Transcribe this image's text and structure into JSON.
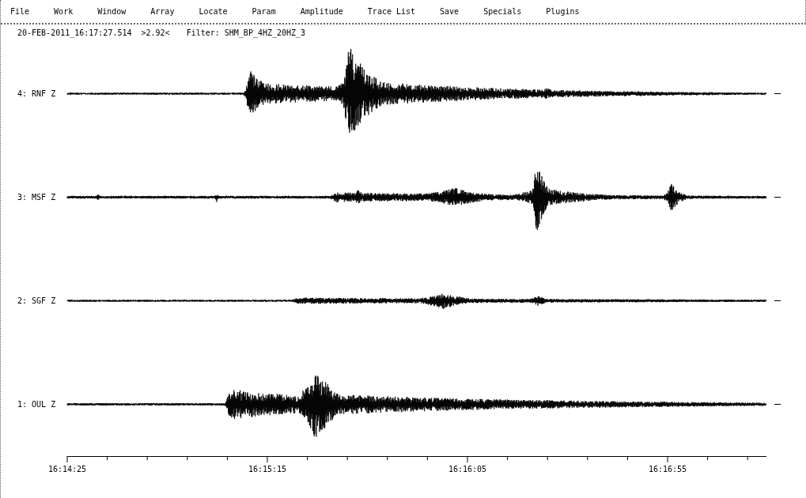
{
  "menu": [
    {
      "label": "File"
    },
    {
      "label": "Work"
    },
    {
      "label": "Window"
    },
    {
      "label": "Array"
    },
    {
      "label": "Locate"
    },
    {
      "label": "Param"
    },
    {
      "label": "Amplitude"
    },
    {
      "label": "Trace List"
    },
    {
      "label": "Save"
    },
    {
      "label": "Specials"
    },
    {
      "label": "Plugins"
    }
  ],
  "header": {
    "timestamp": "20-FEB-2011_16:17:27.514",
    "amplitude": ">2.92<",
    "filter": "Filter: SHM_BP_4HZ_20HZ_3"
  },
  "traces": [
    {
      "label": "4: RNF Z"
    },
    {
      "label": "3: MSF Z"
    },
    {
      "label": "2: SGF Z"
    },
    {
      "label": "1: OUL Z"
    }
  ],
  "time_axis": {
    "labels": [
      "16:14:25",
      "16:15:15",
      "16:16:05",
      "16:16:55"
    ]
  }
}
